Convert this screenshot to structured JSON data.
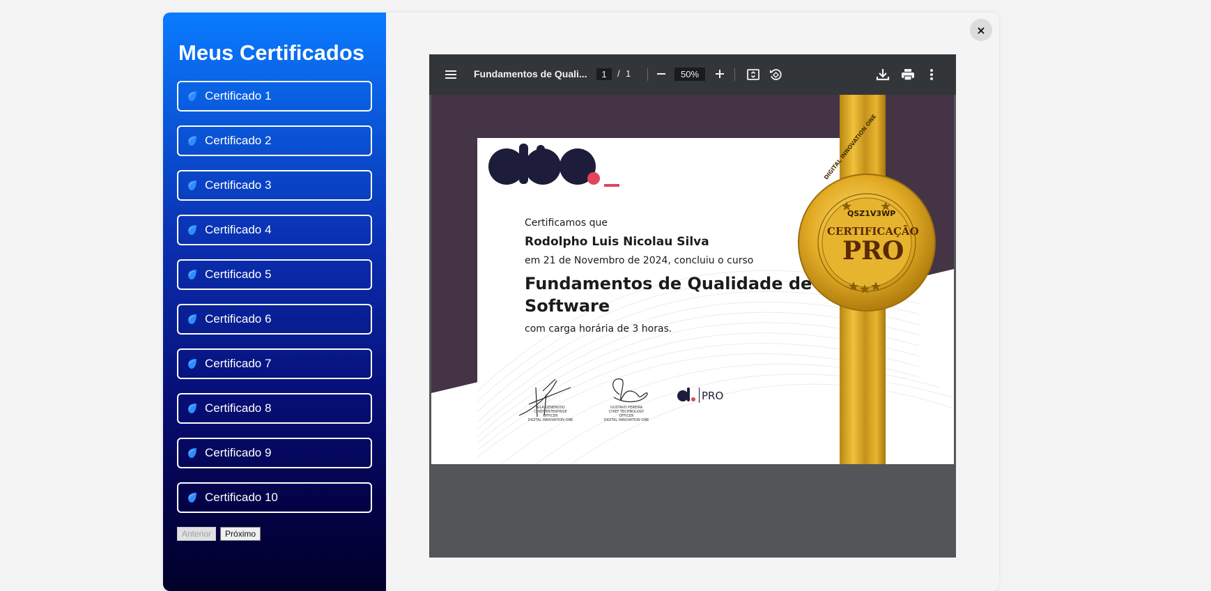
{
  "sidebar": {
    "title": "Meus Certificados",
    "items": [
      {
        "label": "Certificado 1"
      },
      {
        "label": "Certificado 2"
      },
      {
        "label": "Certificado 3"
      },
      {
        "label": "Certificado 4"
      },
      {
        "label": "Certificado 5"
      },
      {
        "label": "Certificado 6"
      },
      {
        "label": "Certificado 7"
      },
      {
        "label": "Certificado 8"
      },
      {
        "label": "Certificado 9"
      },
      {
        "label": "Certificado 10"
      }
    ],
    "pager": {
      "prev": "Anterior",
      "next": "Próximo"
    }
  },
  "close": "×",
  "pdf_viewer": {
    "title": "Fundamentos de Quali...",
    "page_current": "1",
    "page_separator": "/",
    "page_total": "1",
    "zoom": "50%"
  },
  "certificate": {
    "intro": "Certificamos que",
    "name": "Rodolpho Luis Nicolau Silva",
    "date_line": "em 21 de Novembro de 2024, concluiu o curso",
    "course_line1": "Fundamentos de Qualidade de",
    "course_line2": "Software",
    "hours": "com carga horária de 3 horas.",
    "seal": {
      "code": "QSZ1V3WP",
      "title1": "CERTIFICAÇÃO",
      "title2": "PRO",
      "ring_text": "DIGITAL INNOVATION ONE"
    },
    "signatures": [
      {
        "name": "IGLÁ GENEROSO",
        "role": "CHIEF ENTERPRISE OFFICER",
        "org": "DIGITAL INNOVATION ONE"
      },
      {
        "name": "GUSTAVO PEREIRA",
        "role": "CHIEF TECHNOLOGY OFFICER",
        "org": "DIGITAL INNOVATION ONE"
      }
    ],
    "footer_logo": "PRO"
  },
  "colors": {
    "accent_red": "#e0455c",
    "logo_dark": "#1d1c3b",
    "gold": "#d9a521"
  }
}
